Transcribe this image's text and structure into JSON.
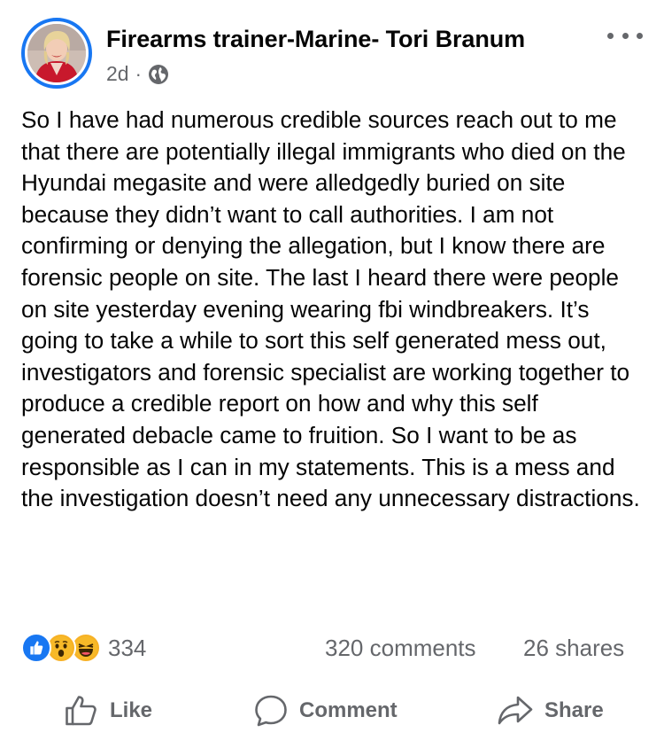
{
  "post": {
    "author": "Firearms trainer-Marine- Tori Branum",
    "time": "2d",
    "separator": "·",
    "audience_icon": "globe-icon",
    "more_icon": "more-options-icon",
    "body": "So I have had numerous credible sources reach out to me that there are potentially illegal immigrants who died on the Hyundai megasite and were alledgedly buried on site because they didn’t want to call authorities. I am not confirming or denying the allegation, but I know there are forensic people on site. The last I heard there were people on site yesterday evening wearing fbi windbreakers.  It’s going to take a while to sort this self generated mess out, investigators and forensic specialist are working together to produce a credible report on how and why this self generated debacle came to fruition. So I want to be as responsible as I can in my statements. This is a mess and the investigation doesn’t need any unnecessary distractions."
  },
  "stats": {
    "reactions": [
      "like",
      "wow",
      "haha"
    ],
    "reaction_count": "334",
    "comments": "320 comments",
    "shares": "26 shares"
  },
  "actions": {
    "like": "Like",
    "comment": "Comment",
    "share": "Share"
  },
  "colors": {
    "accent": "#1877f2",
    "secondary_text": "#65676b",
    "text": "#050505"
  }
}
